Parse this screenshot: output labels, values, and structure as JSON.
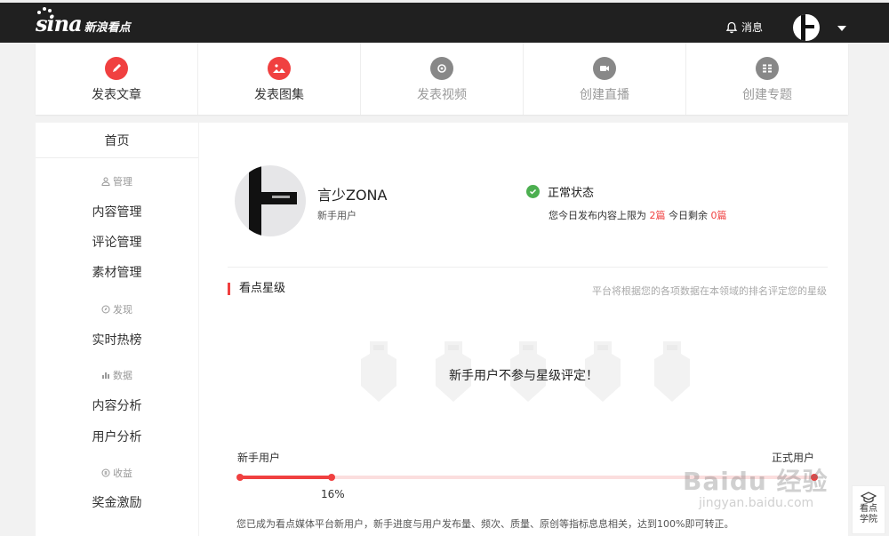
{
  "header": {
    "logo_mark": "sina",
    "logo_text": "新浪看点",
    "messages_label": "消息",
    "bell_icon": "bell-icon",
    "background": "#202020"
  },
  "actions": [
    {
      "label": "发表文章",
      "icon": "pen-icon",
      "color": "#f04040",
      "active": true
    },
    {
      "label": "发表图集",
      "icon": "image-icon",
      "color": "#f04040",
      "active": true
    },
    {
      "label": "发表视频",
      "icon": "video-icon",
      "color": "#888888",
      "active": false
    },
    {
      "label": "创建直播",
      "icon": "camera-icon",
      "color": "#888888",
      "active": false
    },
    {
      "label": "创建专题",
      "icon": "grid-icon",
      "color": "#888888",
      "active": false
    }
  ],
  "sidebar": {
    "home": "首页",
    "groups": {
      "manage": "管理",
      "discover": "发现",
      "data": "数据",
      "income": "收益"
    },
    "items": {
      "content_manage": "内容管理",
      "comment_manage": "评论管理",
      "material_manage": "素材管理",
      "hot_list": "实时热榜",
      "content_analysis": "内容分析",
      "user_analysis": "用户分析",
      "bonus": "奖金激励"
    }
  },
  "profile": {
    "name": "言少ZONA",
    "role": "新手用户",
    "status": "正常状态",
    "limit_prefix": "您今日发布内容上限为",
    "limit_value": "2篇",
    "remaining_prefix": "今日剩余",
    "remaining_value": "0篇"
  },
  "rating": {
    "title": "看点星级",
    "hint": "平台将根据您的各项数据在本领域的排名评定您的星级",
    "message": "新手用户不参与星级评定！"
  },
  "progress": {
    "left_label": "新手用户",
    "right_label": "正式用户",
    "percent_text": "16%",
    "percent": 16,
    "note": "您已成为看点媒体平台新用户，新手进度与用户发布量、频次、质量、原创等指标息息相关，达到100%即可转正。",
    "accent": "#f04040"
  },
  "academy": {
    "line1": "看点",
    "line2": "学院",
    "icon": "graduation-cap-icon"
  },
  "watermark": {
    "main": "Baidu 经验",
    "sub": "jingyan.baidu.com"
  }
}
